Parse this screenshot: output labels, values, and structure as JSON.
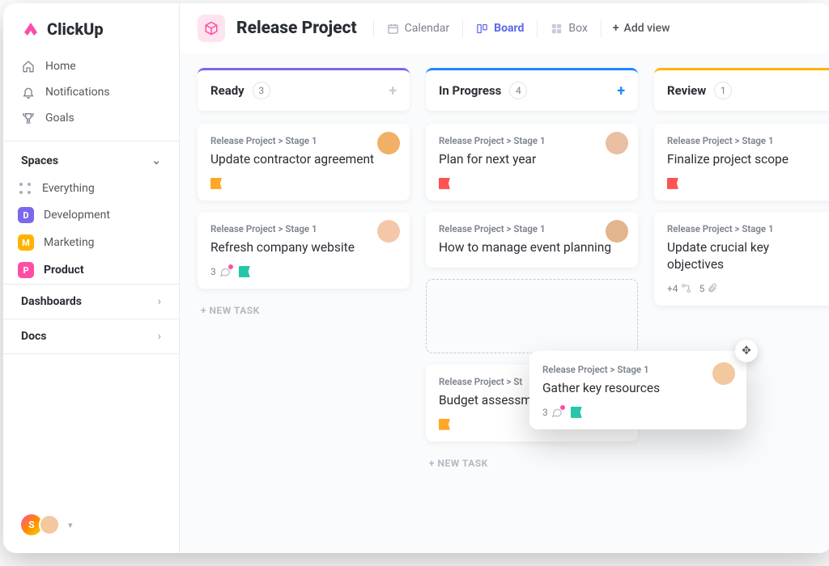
{
  "brand": {
    "name": "ClickUp"
  },
  "nav": {
    "home": "Home",
    "notifications": "Notifications",
    "goals": "Goals"
  },
  "spaces": {
    "heading": "Spaces",
    "everything": "Everything",
    "items": [
      {
        "letter": "D",
        "label": "Development",
        "color": "#7b68ee"
      },
      {
        "letter": "M",
        "label": "Marketing",
        "color": "#ffb300"
      },
      {
        "letter": "P",
        "label": "Product",
        "color": "#ff4da6"
      }
    ]
  },
  "sections": {
    "dashboards": "Dashboards",
    "docs": "Docs"
  },
  "user": {
    "initial": "S"
  },
  "project": {
    "title": "Release Project"
  },
  "views": {
    "calendar": "Calendar",
    "board": "Board",
    "box": "Box",
    "add": "Add view"
  },
  "columns": [
    {
      "name": "Ready",
      "count": "3",
      "accent": "#7b68ee",
      "add_color": "#c9ccd6",
      "cards": [
        {
          "crumb": "Release Project > Stage 1",
          "title": "Update contractor agreement",
          "flag": "orange",
          "avatar": "#f0b065"
        },
        {
          "crumb": "Release Project > Stage 1",
          "title": "Refresh company website",
          "comments": "3",
          "flag": "teal",
          "avatar": "#f5c7a9"
        }
      ],
      "new_task": "+ NEW TASK"
    },
    {
      "name": "In Progress",
      "count": "4",
      "accent": "#1e88ff",
      "add_color": "#1e88ff",
      "cards": [
        {
          "crumb": "Release Project > Stage 1",
          "title": "Plan for next year",
          "flag": "red",
          "avatar": "#e8bfa3"
        },
        {
          "crumb": "Release Project > Stage 1",
          "title": "How to manage event planning",
          "avatar": "#e2b58f"
        },
        {
          "crumb": "Release Project > St",
          "title": "Budget assessment",
          "flag": "orange"
        }
      ],
      "new_task": "+ NEW TASK"
    },
    {
      "name": "Review",
      "count": "1",
      "accent": "#ffb300",
      "add_color": "#c9ccd6",
      "cards": [
        {
          "crumb": "Release Project > Stage 1",
          "title": "Finalize project scope",
          "flag": "red"
        },
        {
          "crumb": "Release Project > Stage 1",
          "title": "Update crucial key objectives",
          "subtasks": "+4",
          "attachments": "5"
        }
      ]
    }
  ],
  "floating_card": {
    "crumb": "Release Project > Stage 1",
    "title": "Gather key resources",
    "comments": "3",
    "flag": "teal",
    "avatar": "#f2c89e"
  }
}
